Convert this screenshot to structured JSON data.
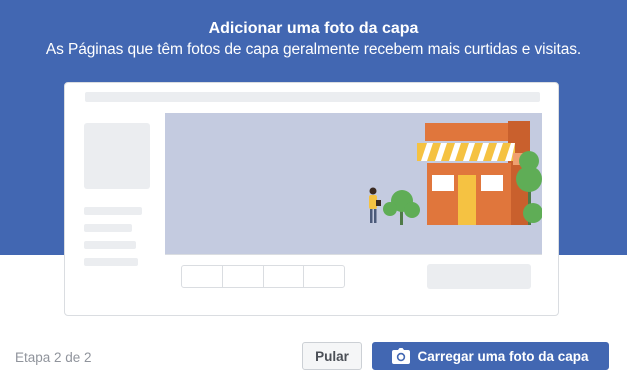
{
  "header": {
    "title": "Adicionar uma foto da capa",
    "subtitle": "As Páginas que têm fotos de capa geralmente recebem mais curtidas e visitas.",
    "background_color": "#4267b2"
  },
  "illustration": {
    "cover_color": "#c4cbe0",
    "store_color": "#e0763c",
    "awning_colors": [
      "#f5c242",
      "#ffffff"
    ],
    "tree_color": "#5fad56"
  },
  "footer": {
    "step_text": "Etapa 2 de 2",
    "skip_label": "Pular",
    "upload_label": "Carregar uma foto da capa",
    "upload_icon": "camera-icon",
    "primary_color": "#4267b2"
  }
}
